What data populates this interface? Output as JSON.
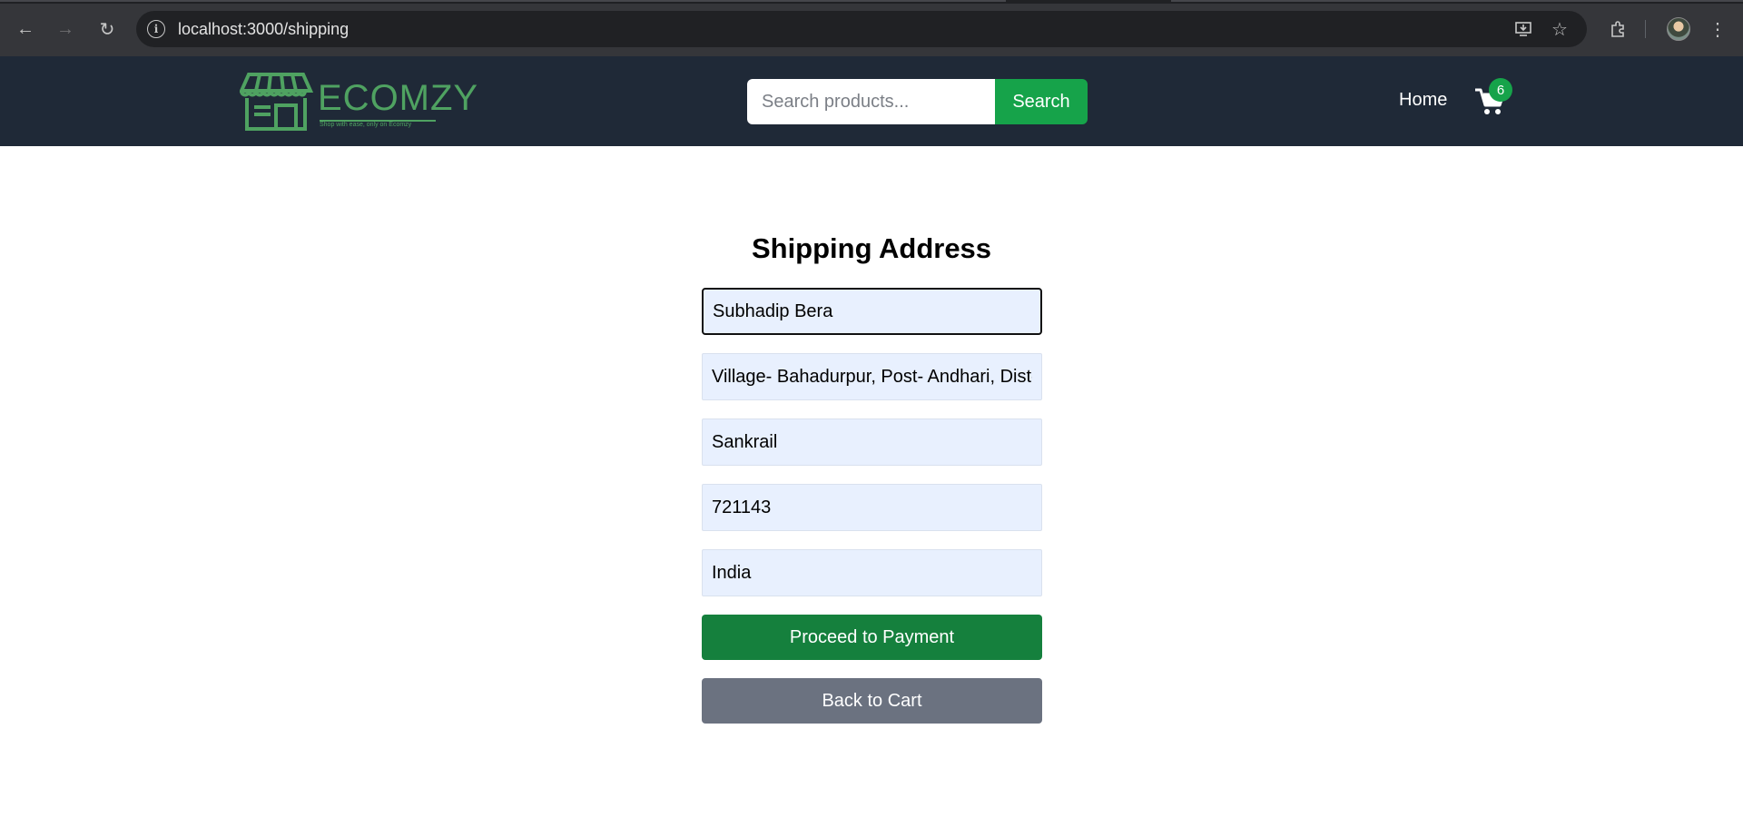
{
  "browser": {
    "url": "localhost:3000/shipping"
  },
  "header": {
    "logo_text": "ECOMZY",
    "logo_tagline": "Shop with ease, only on Ecomzy",
    "search_placeholder": "Search products...",
    "search_button": "Search",
    "home_link": "Home",
    "cart_count": "6"
  },
  "form": {
    "title": "Shipping Address",
    "fields": [
      {
        "name": "full-name",
        "value": "Subhadip Bera"
      },
      {
        "name": "address",
        "value": "Village- Bahadurpur, Post- Andhari, Dist- Paschim Medinipur"
      },
      {
        "name": "city",
        "value": "Sankrail"
      },
      {
        "name": "postal-code",
        "value": "721143"
      },
      {
        "name": "country",
        "value": "India"
      }
    ],
    "proceed_button": "Proceed to Payment",
    "back_button": "Back to Cart"
  },
  "colors": {
    "header_bg": "#1f2937",
    "accent_green": "#16a34a",
    "proceed_green": "#15803d",
    "back_gray": "#6b7280",
    "field_bg": "#e8f0fe"
  }
}
